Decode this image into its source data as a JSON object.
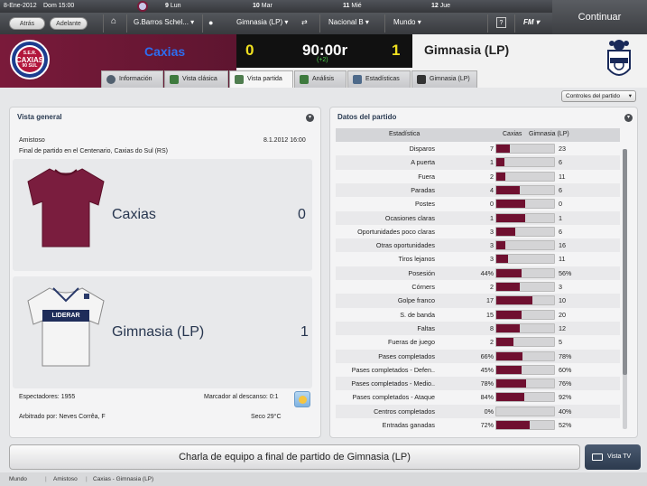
{
  "topbar": {
    "date": "8-Ene-2012",
    "day_time": "Dom 15:00",
    "calendar": [
      {
        "num": "9",
        "label": "Lun"
      },
      {
        "num": "10",
        "label": "Mar"
      },
      {
        "num": "11",
        "label": "Mié"
      },
      {
        "num": "12",
        "label": "Jue"
      }
    ],
    "back_label": "Atrás",
    "forward_label": "Adelante",
    "manager": "G.Barros Schel...",
    "team_select": "Gimnasia (LP)",
    "competition": "Nacional B",
    "world": "Mundo",
    "help": "?",
    "fm_label": "FM",
    "continue_label": "Continuar"
  },
  "scoreboard": {
    "home_team": "Caxias",
    "home_score": "0",
    "match_time": "90:00r",
    "added_time": "(+2)",
    "away_score": "1",
    "away_team": "Gimnasia (LP)",
    "home_crest_text": [
      "S.E.R.",
      "CAXIAS",
      "90 SUL"
    ],
    "colors": {
      "home": "#6e1736",
      "home_name": "#2d6df0",
      "score": "#f0e020"
    }
  },
  "tabs": [
    {
      "label": "Información",
      "icon": "info-icon"
    },
    {
      "label": "Vista clásica",
      "icon": "pitch-icon"
    },
    {
      "label": "Vista partida",
      "icon": "split-view-icon"
    },
    {
      "label": "Análisis",
      "icon": "analysis-icon"
    },
    {
      "label": "Estadísticas",
      "icon": "stats-icon"
    },
    {
      "label": "Gimnasia (LP)",
      "icon": "team-icon"
    }
  ],
  "controls_label": "Controles del partido",
  "overview": {
    "title": "Vista general",
    "competition": "Amistoso",
    "date": "8.1.2012 16:00",
    "venue": "Final de partido en el Centenario, Caxias do Sul (RS)",
    "home": {
      "name": "Caxias",
      "score": "0"
    },
    "away": {
      "name": "Gimnasia (LP)",
      "score": "1",
      "sponsor": "LIDERAR"
    },
    "attendance": "Espectadores: 1955",
    "halftime": "Marcador al descanso: 0:1",
    "referee": "Arbitrado por: Neves Corrêa, F",
    "weather": "Seco 29°C"
  },
  "stats": {
    "title": "Datos del partido",
    "col_stat": "Estadística",
    "col_home": "Caxias",
    "col_away": "Gimnasia (LP)",
    "rows": [
      {
        "name": "Disparos",
        "home": "7",
        "away": "23",
        "share": 0.23
      },
      {
        "name": "A puerta",
        "home": "1",
        "away": "6",
        "share": 0.14
      },
      {
        "name": "Fuera",
        "home": "2",
        "away": "11",
        "share": 0.15
      },
      {
        "name": "Paradas",
        "home": "4",
        "away": "6",
        "share": 0.4
      },
      {
        "name": "Postes",
        "home": "0",
        "away": "0",
        "share": 0.5
      },
      {
        "name": "Ocasiones claras",
        "home": "1",
        "away": "1",
        "share": 0.5
      },
      {
        "name": "Oportunidades poco claras",
        "home": "3",
        "away": "6",
        "share": 0.33
      },
      {
        "name": "Otras oportunidades",
        "home": "3",
        "away": "16",
        "share": 0.16
      },
      {
        "name": "Tiros lejanos",
        "home": "3",
        "away": "11",
        "share": 0.21
      },
      {
        "name": "Posesión",
        "home": "44%",
        "away": "56%",
        "share": 0.44
      },
      {
        "name": "Córners",
        "home": "2",
        "away": "3",
        "share": 0.4
      },
      {
        "name": "Golpe franco",
        "home": "17",
        "away": "10",
        "share": 0.63
      },
      {
        "name": "S. de banda",
        "home": "15",
        "away": "20",
        "share": 0.43
      },
      {
        "name": "Faltas",
        "home": "8",
        "away": "12",
        "share": 0.4
      },
      {
        "name": "Fueras de juego",
        "home": "2",
        "away": "5",
        "share": 0.29
      },
      {
        "name": "Pases completados",
        "home": "66%",
        "away": "78%",
        "share": 0.46
      },
      {
        "name": "Pases completados - Defen..",
        "home": "45%",
        "away": "60%",
        "share": 0.43
      },
      {
        "name": "Pases completados - Medio..",
        "home": "78%",
        "away": "76%",
        "share": 0.51
      },
      {
        "name": "Pases completados - Ataque",
        "home": "84%",
        "away": "92%",
        "share": 0.48
      },
      {
        "name": "Centros completados",
        "home": "0%",
        "away": "40%",
        "share": 0.0
      },
      {
        "name": "Entradas ganadas",
        "home": "72%",
        "away": "52%",
        "share": 0.58
      }
    ]
  },
  "team_talk_label": "Charla de equipo a final de partido de Gimnasia (LP)",
  "tv_label": "Vista TV",
  "breadcrumb": [
    "Mundo",
    "Amistoso",
    "Caxias - Gimnasia (LP)"
  ]
}
